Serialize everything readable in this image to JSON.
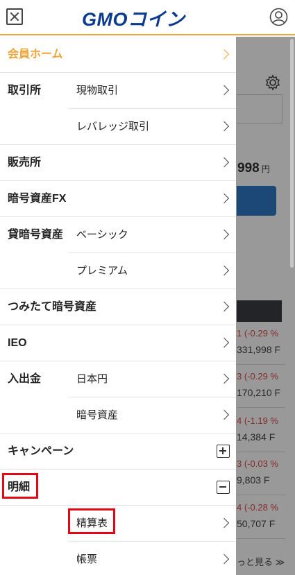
{
  "header": {
    "logo_text": "GMOコイン",
    "close_icon": "close-icon",
    "user_icon": "user-icon"
  },
  "menu": {
    "items": [
      {
        "category": "会員ホーム",
        "highlight_color": "#f0a53a"
      },
      {
        "category": "取引所",
        "sub": "現物取引"
      },
      {
        "sub": "レバレッジ取引"
      },
      {
        "category": "販売所"
      },
      {
        "category": "暗号資産FX"
      },
      {
        "category": "貸暗号資産",
        "sub": "ベーシック"
      },
      {
        "sub": "プレミアム"
      },
      {
        "category": "つみたて暗号資産"
      },
      {
        "category": "IEO"
      },
      {
        "category": "入出金",
        "sub": "日本円"
      },
      {
        "sub": "暗号資産"
      },
      {
        "category": "キャンペーン",
        "toggle": "plus"
      },
      {
        "category": "明細",
        "toggle": "minus"
      },
      {
        "sub": "精算表"
      },
      {
        "sub": "帳票"
      }
    ]
  },
  "background": {
    "price": "998",
    "price_unit": "円",
    "rows": [
      {
        "change": "1 (-0.29 %",
        "value": "331,998 F"
      },
      {
        "change": "3 (-0.29 %",
        "value": "170,210 F"
      },
      {
        "change": "4 (-1.19 %",
        "value": "14,384 F"
      },
      {
        "change": "3 (-0.03 %",
        "value": "9,803 F"
      },
      {
        "change": "4 (-0.28 %",
        "value": "50,707 F"
      }
    ],
    "more_label": "っと見る"
  },
  "colors": {
    "accent": "#f0a53a",
    "logo": "#0a3b8f",
    "highlight_box": "#e30613",
    "negative": "#e04848"
  }
}
